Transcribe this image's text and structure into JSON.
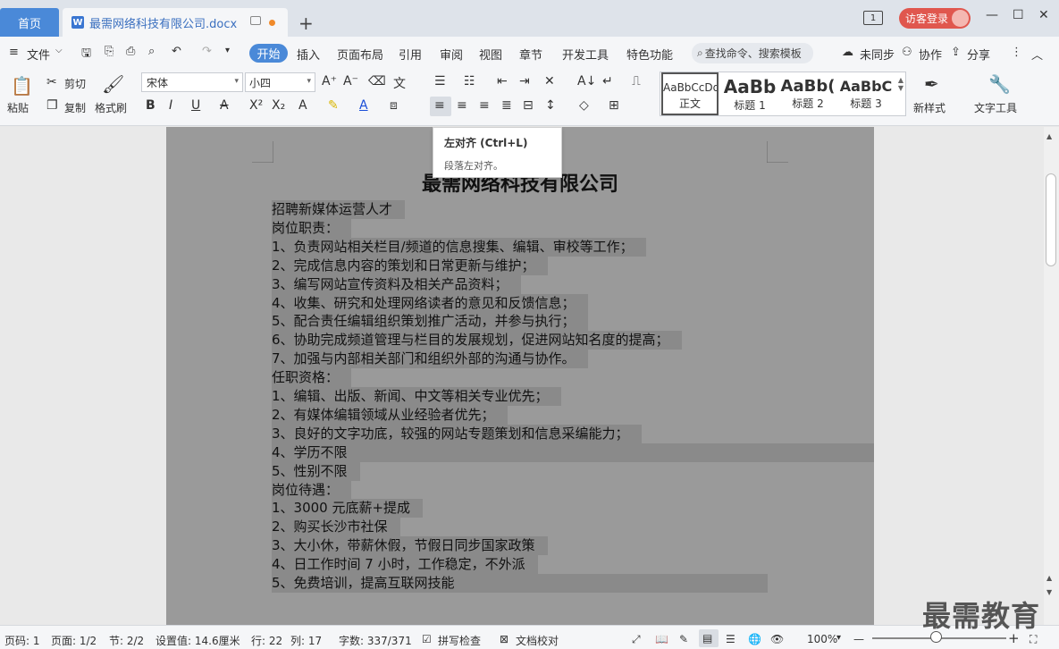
{
  "titlebar": {
    "home_tab": "首页",
    "doc_tab": "最需网络科技有限公司.docx",
    "doc_icon_letter": "W",
    "add_tab": "+",
    "page_badge": "1",
    "login_label": "访客登录",
    "minimize": "—",
    "maximize": "☐",
    "close": "✕"
  },
  "menubar": {
    "file": "文件",
    "items": [
      "开始",
      "插入",
      "页面布局",
      "引用",
      "审阅",
      "视图",
      "章节",
      "开发工具",
      "特色功能"
    ],
    "search_placeholder": "查找命令、搜索模板",
    "sync": "未同步",
    "collab": "协作",
    "share": "分享"
  },
  "ribbon": {
    "paste": "粘贴",
    "cut": "剪切",
    "copy": "复制",
    "format_painter": "格式刷",
    "font_name": "宋体",
    "font_size": "小四",
    "styles": [
      {
        "sample": "AaBbCcDd",
        "name": "正文"
      },
      {
        "sample": "AaBb",
        "name": "标题 1"
      },
      {
        "sample": "AaBb(",
        "name": "标题 2"
      },
      {
        "sample": "AaBbC",
        "name": "标题 3"
      }
    ],
    "new_style": "新样式",
    "text_tools": "文字工具"
  },
  "tooltip": {
    "title": "左对齐 (Ctrl+L)",
    "desc": "段落左对齐。"
  },
  "document": {
    "title": "最需网络科技有限公司",
    "lines": [
      "招聘新媒体运营人才",
      "岗位职责：",
      "1、负责网站相关栏目/频道的信息搜集、编辑、审校等工作；",
      "2、完成信息内容的策划和日常更新与维护；",
      "3、编写网站宣传资料及相关产品资料；",
      "4、收集、研究和处理网络读者的意见和反馈信息；",
      "5、配合责任编辑组织策划推广活动，并参与执行；",
      "6、协助完成频道管理与栏目的发展规划，促进网站知名度的提高；",
      "7、加强与内部相关部门和组织外部的沟通与协作。",
      "任职资格：",
      "1、编辑、出版、新闻、中文等相关专业优先；",
      "2、有媒体编辑领域从业经验者优先；",
      "3、良好的文字功底，较强的网站专题策划和信息采编能力；",
      "4、学历不限",
      "5、性别不限",
      "岗位待遇：",
      "1、3000 元底薪+提成",
      "2、购买长沙市社保",
      "3、大小休，带薪休假，节假日同步国家政策",
      "4、日工作时间 7 小时，工作稳定，不外派",
      "5、免费培训，提高互联网技能"
    ]
  },
  "statusbar": {
    "page_num": "页码: 1",
    "page_count": "页面: 1/2",
    "section": "节: 2/2",
    "setting": "设置值: 14.6厘米",
    "row": "行: 22",
    "col": "列: 17",
    "word_count": "字数: 337/371",
    "spell_check": "拼写检查",
    "doc_proof": "文档校对",
    "zoom": "100%",
    "zoom_minus": "—",
    "zoom_plus": "+"
  },
  "watermark": "最需教育",
  "colors": {
    "accent": "#4a89d8",
    "login": "#e0574e",
    "selection": "#8a8a8a"
  }
}
